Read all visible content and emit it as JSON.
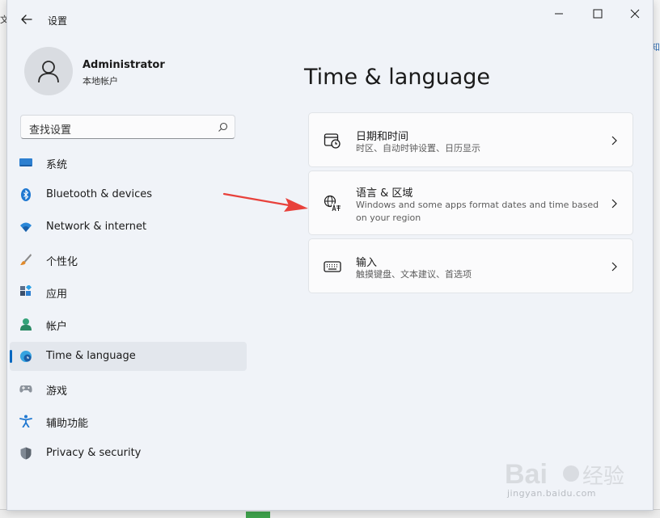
{
  "window": {
    "title": "设置",
    "back_icon": "back-arrow-icon",
    "controls": [
      "minimize-icon",
      "maximize-icon",
      "close-icon"
    ]
  },
  "user": {
    "name": "Administrator",
    "account_type": "本地帐户",
    "avatar_icon": "person-icon"
  },
  "search": {
    "placeholder": "查找设置",
    "icon": "search-icon"
  },
  "nav": {
    "items": [
      {
        "label": "系统",
        "icon": "system-icon",
        "selected": false
      },
      {
        "label": "Bluetooth & devices",
        "icon": "bluetooth-icon",
        "selected": false
      },
      {
        "label": "Network & internet",
        "icon": "wifi-icon",
        "selected": false
      },
      {
        "label": "个性化",
        "icon": "brush-icon",
        "selected": false
      },
      {
        "label": "应用",
        "icon": "apps-icon",
        "selected": false
      },
      {
        "label": "帐户",
        "icon": "account-icon",
        "selected": false
      },
      {
        "label": "Time & language",
        "icon": "globe-clock-icon",
        "selected": true
      },
      {
        "label": "游戏",
        "icon": "gamepad-icon",
        "selected": false
      },
      {
        "label": "辅助功能",
        "icon": "accessibility-icon",
        "selected": false
      },
      {
        "label": "Privacy & security",
        "icon": "shield-icon",
        "selected": false
      }
    ]
  },
  "main": {
    "title": "Time & language",
    "cards": [
      {
        "title": "日期和时间",
        "subtitle": "时区、自动时钟设置、日历显示",
        "icon": "calendar-clock-icon"
      },
      {
        "title": "语言 & 区域",
        "subtitle": "Windows and some apps format dates and time based on your region",
        "icon": "language-icon"
      },
      {
        "title": "输入",
        "subtitle": "触摸键盘、文本建议、首选项",
        "icon": "keyboard-icon"
      }
    ]
  },
  "background": {
    "left_char": "文",
    "right_char": "知"
  },
  "watermark": {
    "url": "jingyan.baidu.com"
  },
  "colors": {
    "accent": "#0067c0",
    "annotation_arrow": "#e8413b",
    "window_bg": "#f0f3f8",
    "card_bg": "#fbfbfc"
  }
}
